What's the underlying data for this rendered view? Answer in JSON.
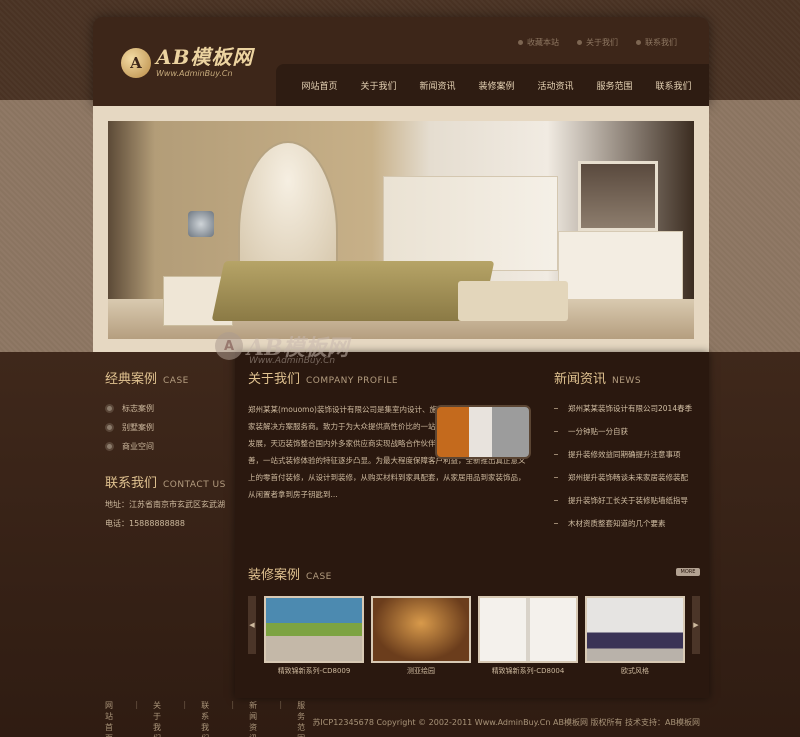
{
  "header": {
    "logo_mark": "A",
    "logo_title": "AB模板网",
    "logo_sub": "Www.AdminBuy.Cn",
    "toplinks": [
      "收藏本站",
      "关于我们",
      "联系我们"
    ]
  },
  "nav": [
    "网站首页",
    "关于我们",
    "新闻资讯",
    "装修案例",
    "活动资讯",
    "服务范围",
    "联系我们"
  ],
  "sidebar": {
    "case_title": "经典案例",
    "case_title_en": "CASE",
    "case_items": [
      "标志案例",
      "别墅案例",
      "商业空间"
    ],
    "contact_title": "联系我们",
    "contact_title_en": "CONTACT US",
    "address": "地址：江苏省南京市玄武区玄武湖",
    "phone": "电话：15888888888"
  },
  "about": {
    "title": "关于我们",
    "title_en": "COMPANY PROFILE",
    "text": "郑州某某(mouomo)装饰设计有限公司是集室内设计、施工、产品配套为一体的整体家装解决方案服务商。致力于为大众提供高性价比的一站式装修体验。 经过近几年的发展，天迈装饰整合国内外多家供应商实现战略合作伙伴关系，产品经营覆盖日益完善，一站式装修体验的特征逐步凸显。为最大程度保障客户利益，全新推出真正意义上的零首付装修，从设计到装修，从购买材料到家具配套，从家居用品到家装饰品，从闲置者拿到房子钥匙到..."
  },
  "news": {
    "title": "新闻资讯",
    "title_en": "NEWS",
    "items": [
      "郑州某某装饰设计有限公司2014春季",
      "一分钟贴一分自获",
      "提升装修效益同期确提升注意事项",
      "郑州提升装饰畅谈未来家居装修装配",
      "提升装饰好工长关于装修贴墙纸指导",
      "木材资质整套知道的几个要素"
    ]
  },
  "cases": {
    "title": "装修案例",
    "title_en": "CASE",
    "more": "MORE",
    "arrow_left": "◀",
    "arrow_right": "▶",
    "items": [
      {
        "caption": "精致锦新系列-CD8009"
      },
      {
        "caption": "测亚绘园"
      },
      {
        "caption": "精致锦新系列-CD8004"
      },
      {
        "caption": "欧式风格"
      }
    ]
  },
  "watermark": {
    "mark": "A",
    "title": "AB模板网",
    "sub": "Www.AdminBuy.Cn"
  },
  "footer": {
    "links": [
      "网站首页",
      "关于我们",
      "联系我们",
      "新闻资讯",
      "服务范围"
    ],
    "separator": "|",
    "copyright": "苏ICP12345678  Copyright © 2002-2011 Www.AdminBuy.Cn AB模板网 版权所有  技术支持：AB模板网"
  }
}
